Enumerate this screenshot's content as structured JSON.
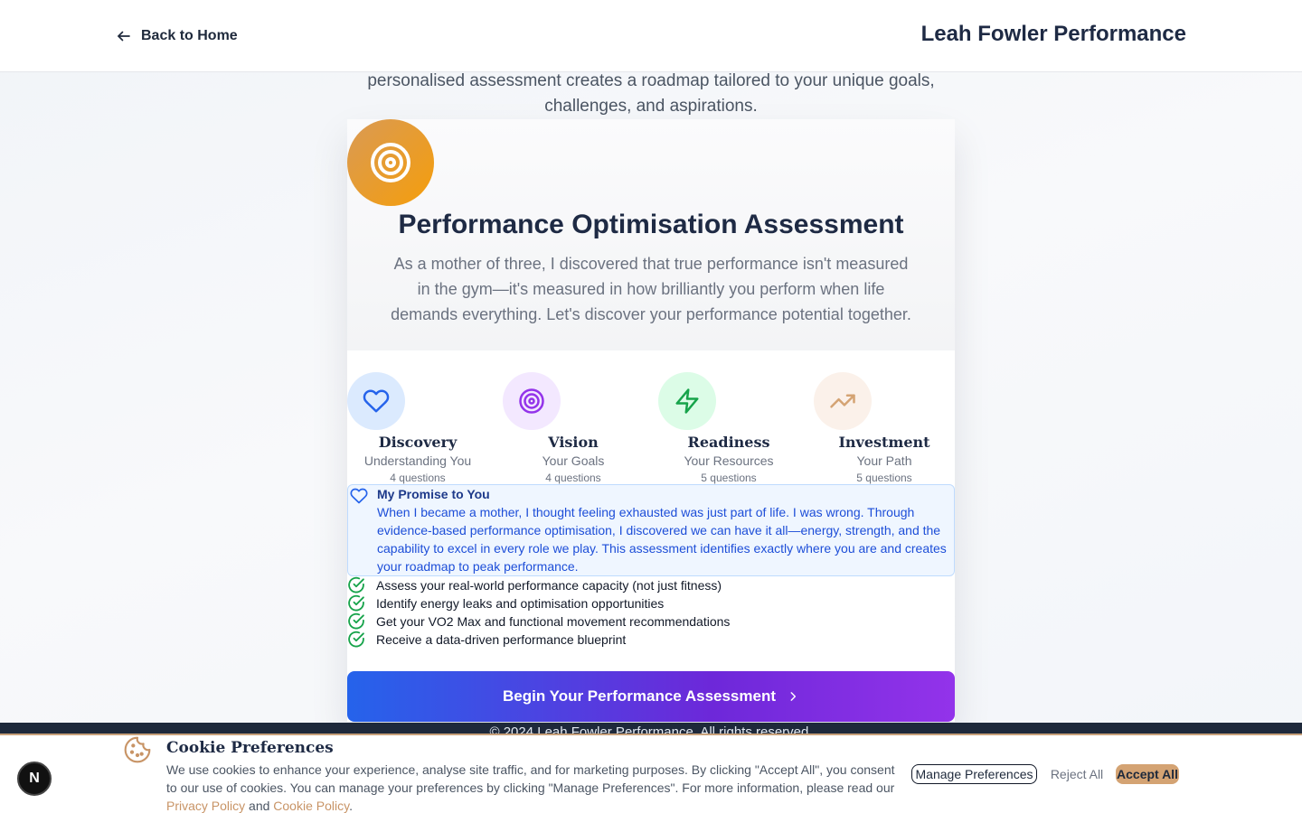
{
  "header": {
    "back_label": "Back to Home",
    "brand": "Leah Fowler Performance"
  },
  "intro": {
    "text": "personalised assessment creates a roadmap tailored to your unique goals, challenges, and aspirations."
  },
  "card": {
    "title": "Performance Optimisation Assessment",
    "description": "As a mother of three, I discovered that true performance isn't measured in the gym—it's measured in how brilliantly you perform when life demands everything. Let's discover your performance potential together.",
    "steps": [
      {
        "name": "Discovery",
        "subtitle": "Understanding You",
        "count": "4 questions",
        "icon": "heart-icon"
      },
      {
        "name": "Vision",
        "subtitle": "Your Goals",
        "count": "4 questions",
        "icon": "target-icon"
      },
      {
        "name": "Readiness",
        "subtitle": "Your Resources",
        "count": "5 questions",
        "icon": "zap-icon"
      },
      {
        "name": "Investment",
        "subtitle": "Your Path",
        "count": "5 questions",
        "icon": "trending-up-icon"
      }
    ],
    "promise": {
      "title": "My Promise to You",
      "text": "When I became a mother, I thought feeling exhausted was just part of life. I was wrong. Through evidence-based performance optimisation, I discovered we can have it all—energy, strength, and the capability to excel in every role we play. This assessment identifies exactly where you are and creates your roadmap to peak performance."
    },
    "checklist": [
      "Assess your real-world performance capacity (not just fitness)",
      "Identify energy leaks and optimisation opportunities",
      "Get your VO2 Max and functional movement recommendations",
      "Receive a data-driven performance blueprint"
    ],
    "cta_label": "Begin Your Performance Assessment"
  },
  "footer": {
    "copyright": "© 2024 Leah Fowler Performance. All rights reserved."
  },
  "cookie": {
    "title": "Cookie Preferences",
    "text_before": "We use cookies to enhance your experience, analyse site traffic, and for marketing purposes. By clicking \"Accept All\", you consent to our use of cookies. You can manage your preferences by clicking \"Manage Preferences\". For more information, please read our ",
    "privacy_link": "Privacy Policy",
    "and": " and ",
    "cookie_link": "Cookie Policy",
    "period": ".",
    "manage_label": "Manage Preferences",
    "reject_label": "Reject All",
    "accept_label": "Accept All"
  },
  "floating_badge": "N",
  "colors": {
    "accent_gold": "#d4a373",
    "brand_navy": "#1e2a44",
    "cta_start": "#2563eb",
    "cta_end": "#9333ea",
    "check_green": "#16a34a"
  }
}
